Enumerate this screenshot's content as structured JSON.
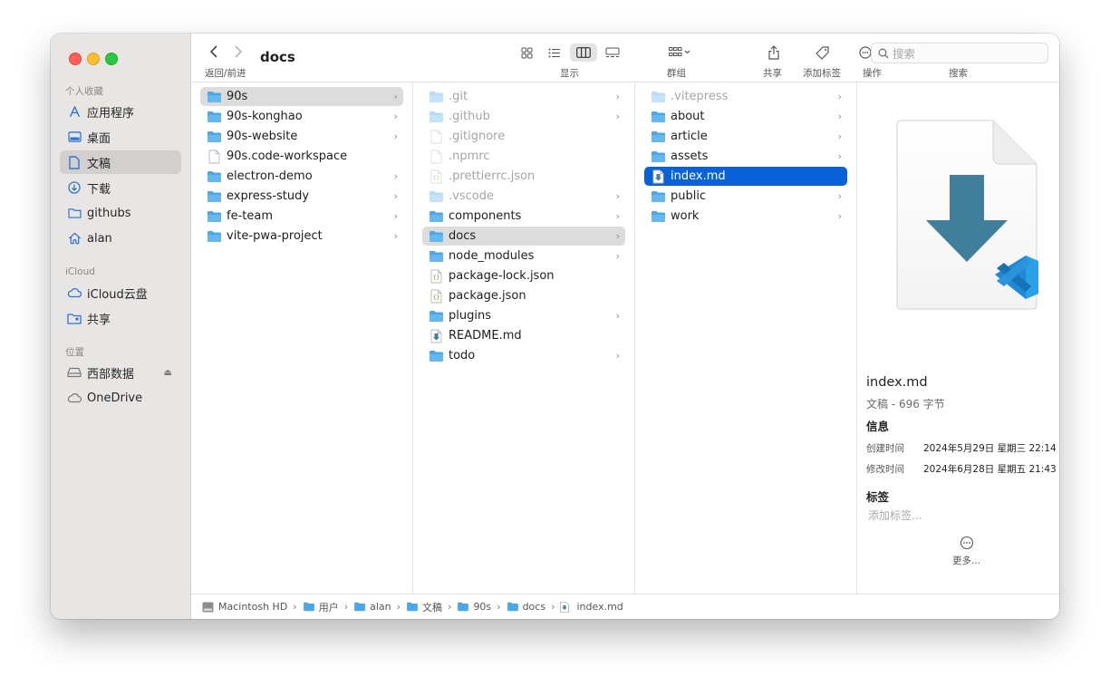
{
  "sidebar": {
    "favorites_header": "个人收藏",
    "favorites": [
      {
        "label": "应用程序",
        "icon": "applications-icon"
      },
      {
        "label": "桌面",
        "icon": "desktop-icon"
      },
      {
        "label": "文稿",
        "icon": "document-icon",
        "selected": true
      },
      {
        "label": "下载",
        "icon": "download-icon"
      },
      {
        "label": "githubs",
        "icon": "folder-icon"
      },
      {
        "label": "alan",
        "icon": "home-icon"
      }
    ],
    "icloud_header": "iCloud",
    "icloud": [
      {
        "label": "iCloud云盘",
        "icon": "cloud-icon"
      },
      {
        "label": "共享",
        "icon": "shared-folder-icon"
      }
    ],
    "locations_header": "位置",
    "locations": [
      {
        "label": "西部数据",
        "icon": "drive-icon",
        "eject": true
      },
      {
        "label": "OneDrive",
        "icon": "cloud-icon"
      }
    ]
  },
  "toolbar": {
    "title": "docs",
    "nav_caption": "返回/前进",
    "view_caption": "显示",
    "group_caption": "群组",
    "share_caption": "共享",
    "tag_caption": "添加标签",
    "action_caption": "操作",
    "search_placeholder": "搜索",
    "search_caption": "搜索"
  },
  "columns": [
    {
      "items": [
        {
          "name": "90s",
          "type": "folder",
          "chevron": true,
          "state": "gray"
        },
        {
          "name": "90s-konghao",
          "type": "folder",
          "chevron": true
        },
        {
          "name": "90s-website",
          "type": "folder",
          "chevron": true
        },
        {
          "name": "90s.code-workspace",
          "type": "file",
          "chevron": false
        },
        {
          "name": "electron-demo",
          "type": "folder",
          "chevron": true
        },
        {
          "name": "express-study",
          "type": "folder",
          "chevron": true
        },
        {
          "name": "fe-team",
          "type": "folder",
          "chevron": true
        },
        {
          "name": "vite-pwa-project",
          "type": "folder",
          "chevron": true
        }
      ]
    },
    {
      "items": [
        {
          "name": ".git",
          "type": "folder",
          "chevron": true,
          "dim": true
        },
        {
          "name": ".github",
          "type": "folder",
          "chevron": true,
          "dim": true
        },
        {
          "name": ".gitignore",
          "type": "file",
          "chevron": false,
          "dim": true
        },
        {
          "name": ".npmrc",
          "type": "file",
          "chevron": false,
          "dim": true
        },
        {
          "name": ".prettierrc.json",
          "type": "json",
          "chevron": false,
          "dim": true
        },
        {
          "name": ".vscode",
          "type": "folder",
          "chevron": true,
          "dim": true
        },
        {
          "name": "components",
          "type": "folder",
          "chevron": true
        },
        {
          "name": "docs",
          "type": "folder",
          "chevron": true,
          "state": "gray"
        },
        {
          "name": "node_modules",
          "type": "folder",
          "chevron": true
        },
        {
          "name": "package-lock.json",
          "type": "json",
          "chevron": false
        },
        {
          "name": "package.json",
          "type": "json",
          "chevron": false
        },
        {
          "name": "plugins",
          "type": "folder",
          "chevron": true
        },
        {
          "name": "README.md",
          "type": "md",
          "chevron": false
        },
        {
          "name": "todo",
          "type": "folder",
          "chevron": true
        }
      ]
    },
    {
      "items": [
        {
          "name": ".vitepress",
          "type": "folder",
          "chevron": true,
          "dim": true
        },
        {
          "name": "about",
          "type": "folder",
          "chevron": true
        },
        {
          "name": "article",
          "type": "folder",
          "chevron": true
        },
        {
          "name": "assets",
          "type": "folder",
          "chevron": true
        },
        {
          "name": "index.md",
          "type": "md",
          "chevron": false,
          "state": "blue"
        },
        {
          "name": "public",
          "type": "folder",
          "chevron": true
        },
        {
          "name": "work",
          "type": "folder",
          "chevron": true
        }
      ]
    }
  ],
  "preview": {
    "name": "index.md",
    "kind": "文稿 - 696 字节",
    "info_header": "信息",
    "created_label": "创建时间",
    "created_value": "2024年5月29日 星期三 22:14",
    "modified_label": "修改时间",
    "modified_value": "2024年6月28日 星期五 21:43",
    "tags_header": "标签",
    "tags_placeholder": "添加标签...",
    "more_label": "更多..."
  },
  "pathbar": [
    {
      "label": "Macintosh HD",
      "icon": "hard-drive-icon"
    },
    {
      "label": "用户",
      "icon": "folder-icon"
    },
    {
      "label": "alan",
      "icon": "folder-icon"
    },
    {
      "label": "文稿",
      "icon": "folder-icon"
    },
    {
      "label": "90s",
      "icon": "folder-icon"
    },
    {
      "label": "docs",
      "icon": "folder-icon"
    },
    {
      "label": "index.md",
      "icon": "md-file-icon"
    }
  ],
  "colors": {
    "accent": "#0a62d8",
    "folder": "#4aa8e8",
    "sidebar_bg": "#e8e6e5",
    "vscode_blue": "#1f8ad2"
  }
}
